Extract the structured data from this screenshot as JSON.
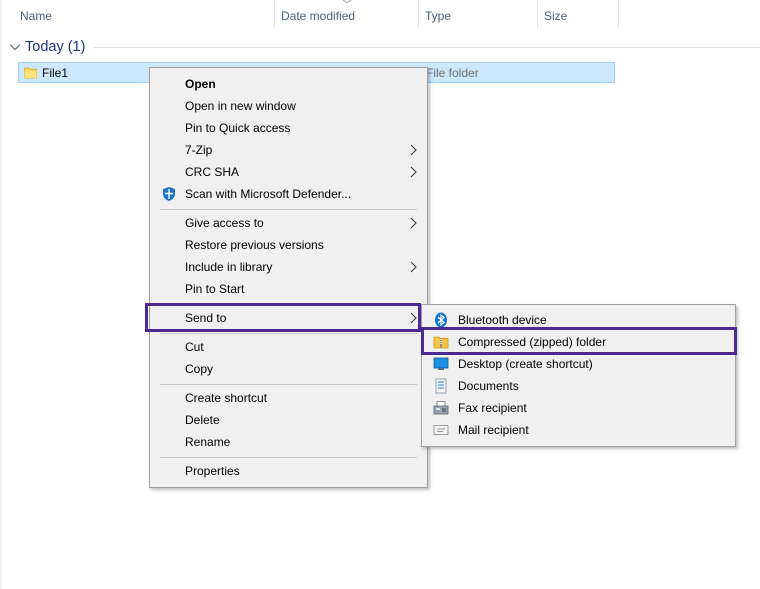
{
  "columns": {
    "name": "Name",
    "date_modified": "Date modified",
    "type": "Type",
    "size": "Size"
  },
  "group": {
    "label": "Today (1)"
  },
  "file": {
    "name": "File1",
    "type": "File folder"
  },
  "context_menu": {
    "items": [
      {
        "label": "Open"
      },
      {
        "label": "Open in new window"
      },
      {
        "label": "Pin to Quick access"
      },
      {
        "label": "7-Zip"
      },
      {
        "label": "CRC SHA"
      },
      {
        "label": "Scan with Microsoft Defender..."
      },
      {
        "label": "Give access to"
      },
      {
        "label": "Restore previous versions"
      },
      {
        "label": "Include in library"
      },
      {
        "label": "Pin to Start"
      },
      {
        "label": "Send to"
      },
      {
        "label": "Cut"
      },
      {
        "label": "Copy"
      },
      {
        "label": "Create shortcut"
      },
      {
        "label": "Delete"
      },
      {
        "label": "Rename"
      },
      {
        "label": "Properties"
      }
    ]
  },
  "send_to_menu": {
    "items": [
      {
        "label": "Bluetooth device",
        "icon": "bluetooth-icon"
      },
      {
        "label": "Compressed (zipped) folder",
        "icon": "zip-folder-icon"
      },
      {
        "label": "Desktop (create shortcut)",
        "icon": "desktop-icon"
      },
      {
        "label": "Documents",
        "icon": "documents-icon"
      },
      {
        "label": "Fax recipient",
        "icon": "fax-icon"
      },
      {
        "label": "Mail recipient",
        "icon": "mail-icon"
      }
    ]
  },
  "colors": {
    "highlight_box": "#4b2b93",
    "selection_bg": "#cce8ff",
    "group_header": "#1e3287",
    "column_header": "#4c607a"
  }
}
